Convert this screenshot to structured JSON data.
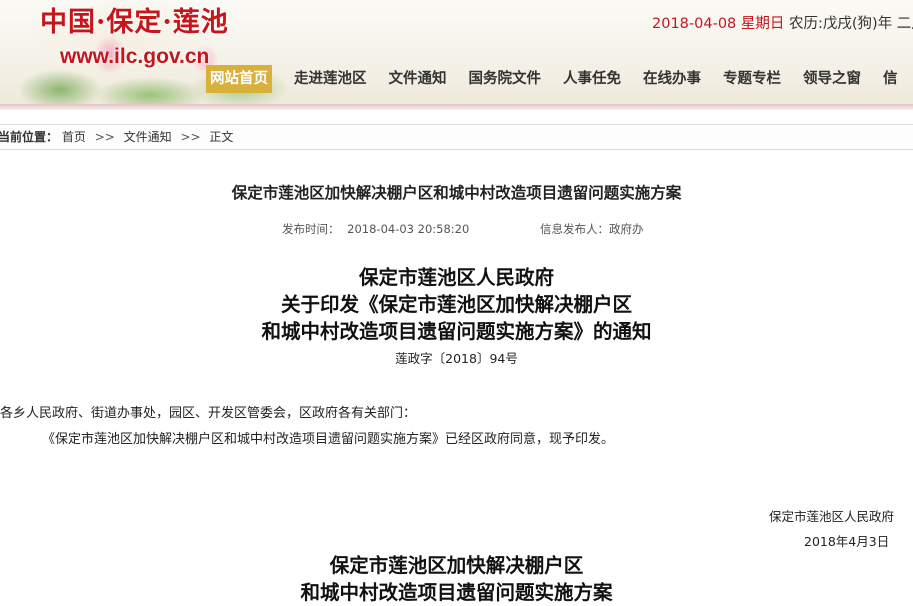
{
  "header": {
    "site_title": "中国·保定·莲池",
    "site_url": "www.ilc.gov.cn",
    "date": "2018-04-08",
    "weekday": "星期日",
    "lunar": "农历:戊戌(狗)年 二月"
  },
  "nav": {
    "items": [
      {
        "label": "网站首页",
        "active": true
      },
      {
        "label": "走进莲池区"
      },
      {
        "label": "文件通知"
      },
      {
        "label": "国务院文件"
      },
      {
        "label": "人事任免"
      },
      {
        "label": "在线办事"
      },
      {
        "label": "专题专栏"
      },
      {
        "label": "领导之窗"
      },
      {
        "label": "信"
      }
    ]
  },
  "breadcrumb": {
    "label": "当前位置：",
    "items": [
      "首页",
      "文件通知",
      "正文"
    ],
    "separator": ">>"
  },
  "article": {
    "title": "保定市莲池区加快解决棚户区和城中村改造项目遗留问题实施方案",
    "publish_label": "发布时间：",
    "publish_time": "2018-04-03 20:58:20",
    "publisher_label": "信息发布人：",
    "publisher": "政府办",
    "doc_heading": [
      "保定市莲池区人民政府",
      "关于印发《保定市莲池区加快解决棚户区",
      "和城中村改造项目遗留问题实施方案》的通知"
    ],
    "doc_number": "莲政字〔2018〕94号",
    "addressee": "各乡人民政府、街道办事处，园区、开发区管委会，区政府各有关部门：",
    "body": "《保定市莲池区加快解决棚户区和城中村改造项目遗留问题实施方案》已经区政府同意，现予印发。",
    "signer": "保定市莲池区人民政府",
    "sign_date": "2018年4月3日",
    "attachment_heading": [
      "保定市莲池区加快解决棚户区",
      "和城中村改造项目遗留问题实施方案"
    ]
  },
  "colors": {
    "brand_red": "#c4161c",
    "nav_active_bg": "#d8b03c"
  }
}
